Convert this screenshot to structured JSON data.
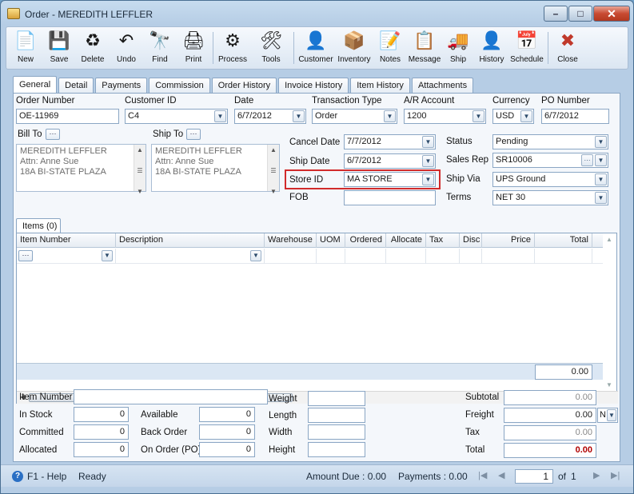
{
  "window": {
    "title": "Order - MEREDITH LEFFLER",
    "minimize": "–",
    "maximize": "□",
    "close": "✕"
  },
  "toolbar": [
    {
      "label": "New",
      "icon": "new-document-icon",
      "glyph": "📄"
    },
    {
      "label": "Save",
      "icon": "save-disk-icon",
      "glyph": "💾"
    },
    {
      "label": "Delete",
      "icon": "recycle-bin-icon",
      "glyph": "♻"
    },
    {
      "label": "Undo",
      "icon": "undo-arrow-icon",
      "glyph": "↶"
    },
    {
      "label": "Find",
      "icon": "binoculars-icon",
      "glyph": "🔭"
    },
    {
      "label": "Print",
      "icon": "printer-icon",
      "glyph": "🖨"
    },
    {
      "label": "Process",
      "icon": "process-icon",
      "glyph": "⚙"
    },
    {
      "label": "Tools",
      "icon": "tools-icon",
      "glyph": "🛠"
    },
    {
      "label": "Customer",
      "icon": "customer-icon",
      "glyph": "👤"
    },
    {
      "label": "Inventory",
      "icon": "inventory-boxes-icon",
      "glyph": "📦"
    },
    {
      "label": "Notes",
      "icon": "notes-pencil-icon",
      "glyph": "📝"
    },
    {
      "label": "Message",
      "icon": "message-icon",
      "glyph": "📋"
    },
    {
      "label": "Ship",
      "icon": "ship-forklift-icon",
      "glyph": "🚚"
    },
    {
      "label": "History",
      "icon": "history-icon",
      "glyph": "👤"
    },
    {
      "label": "Schedule",
      "icon": "schedule-calendar-icon",
      "glyph": "📅"
    },
    {
      "label": "Close",
      "icon": "close-window-icon",
      "glyph": "✖"
    }
  ],
  "tabs": [
    "General",
    "Detail",
    "Payments",
    "Commission",
    "Order History",
    "Invoice History",
    "Item History",
    "Attachments"
  ],
  "header": {
    "order_number": {
      "label": "Order Number",
      "value": "OE-11969"
    },
    "customer_id": {
      "label": "Customer ID",
      "value": "C4"
    },
    "date": {
      "label": "Date",
      "value": "6/7/2012"
    },
    "transaction_type": {
      "label": "Transaction Type",
      "value": "Order"
    },
    "ar_account": {
      "label": "A/R Account",
      "value": "1200"
    },
    "currency": {
      "label": "Currency",
      "value": "USD"
    },
    "po_number": {
      "label": "PO Number",
      "value": "6/7/2012"
    }
  },
  "bill_to": {
    "label": "Bill To",
    "lines": [
      "MEREDITH LEFFLER",
      "Attn: Anne Sue",
      "18A BI-STATE PLAZA"
    ]
  },
  "ship_to": {
    "label": "Ship To",
    "lines": [
      "MEREDITH LEFFLER",
      "Attn: Anne Sue",
      "18A BI-STATE PLAZA"
    ]
  },
  "dates": {
    "cancel_date": {
      "label": "Cancel  Date",
      "value": "7/7/2012"
    },
    "ship_date": {
      "label": "Ship Date",
      "value": "6/7/2012"
    },
    "store_id": {
      "label": "Store ID",
      "value": "MA STORE"
    },
    "fob": {
      "label": "FOB",
      "value": ""
    }
  },
  "right": {
    "status": {
      "label": "Status",
      "value": "Pending"
    },
    "sales_rep": {
      "label": "Sales Rep",
      "value": "SR10006"
    },
    "ship_via": {
      "label": "Ship Via",
      "value": "UPS Ground"
    },
    "terms": {
      "label": "Terms",
      "value": "NET 30"
    }
  },
  "items": {
    "tab_label": "Items (0)",
    "columns": [
      "Item Number",
      "Description",
      "Warehouse",
      "UOM",
      "Ordered",
      "Allocate",
      "Tax",
      "Disc",
      "Price",
      "Total"
    ],
    "grand_total": "0.00"
  },
  "bottom": {
    "item_number": {
      "label": "Item Number",
      "value": ""
    },
    "in_stock": {
      "label": "In Stock",
      "value": "0"
    },
    "committed": {
      "label": "Committed",
      "value": "0"
    },
    "allocated": {
      "label": "Allocated",
      "value": "0"
    },
    "available": {
      "label": "Available",
      "value": "0"
    },
    "back_order": {
      "label": "Back Order",
      "value": "0"
    },
    "on_order": {
      "label": "On Order (PO)",
      "value": "0"
    },
    "weight": {
      "label": "Weight",
      "value": ""
    },
    "length": {
      "label": "Length",
      "value": ""
    },
    "width": {
      "label": "Width",
      "value": ""
    },
    "height": {
      "label": "Height",
      "value": ""
    },
    "subtotal": {
      "label": "Subtotal",
      "value": "0.00"
    },
    "freight": {
      "label": "Freight",
      "value": "0.00",
      "code": "N"
    },
    "tax": {
      "label": "Tax",
      "value": "0.00"
    },
    "total": {
      "label": "Total",
      "value": "0.00"
    }
  },
  "status_bar": {
    "help": "F1 - Help",
    "state": "Ready",
    "amount_due": "Amount Due : 0.00",
    "payments": "Payments : 0.00",
    "page": "1",
    "of": "of",
    "page_count": "1"
  },
  "colors": {
    "highlight_border": "#d12b2b",
    "total_text": "#b00000"
  }
}
